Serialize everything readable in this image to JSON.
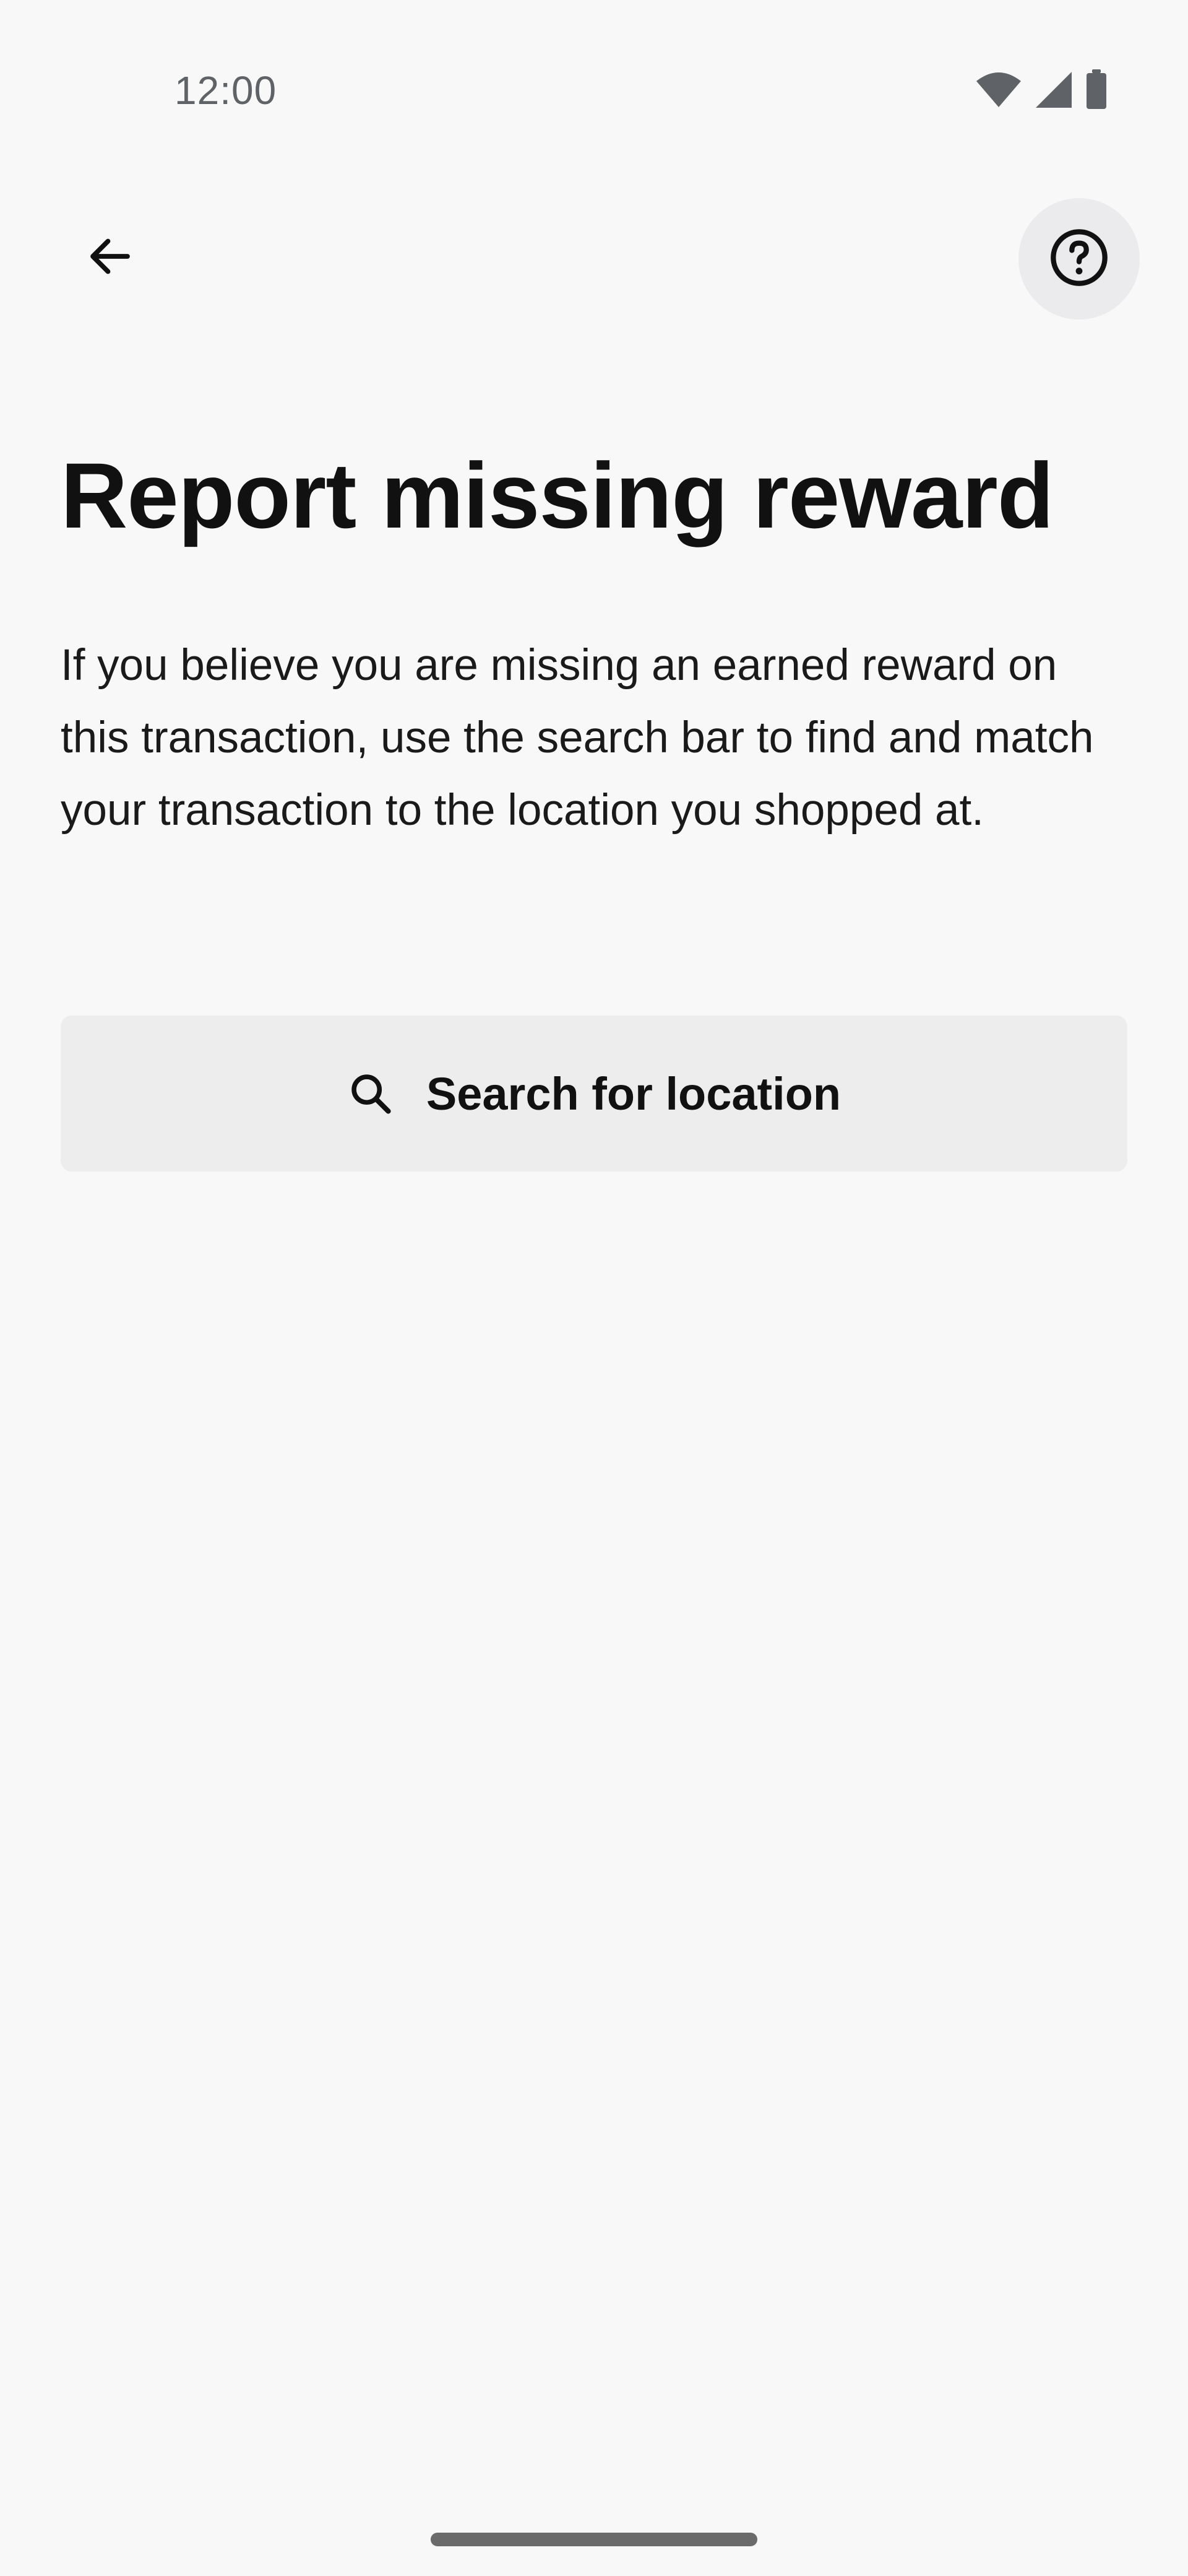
{
  "status_bar": {
    "time": "12:00",
    "icons": [
      "wifi-icon",
      "cellular-signal-icon",
      "battery-icon"
    ]
  },
  "top_bar": {
    "back_icon": "arrow-left-icon",
    "help_icon": "question-circle-icon"
  },
  "page": {
    "title": "Report missing reward",
    "description": "If you believe you are missing an earned reward on this transaction, use the search bar to find and match your transaction to the location you shopped at."
  },
  "search": {
    "icon": "search-icon",
    "label": "Search for location"
  },
  "colors": {
    "background": "#f7f8f7",
    "button_background": "#ededee",
    "help_button_background": "#ebebed",
    "text": "#111111",
    "status_text": "#5f6368"
  }
}
